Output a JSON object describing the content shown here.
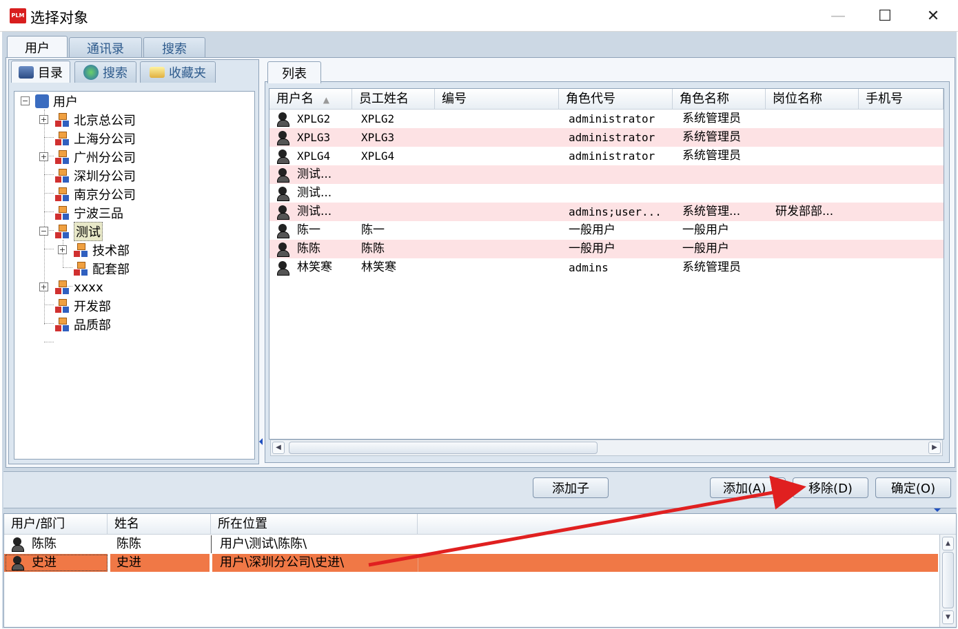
{
  "window": {
    "logo": "PLM",
    "title": "选择对象",
    "min_symbol": "—",
    "max_symbol": "☐",
    "close_symbol": "✕"
  },
  "main_tabs": [
    {
      "label": "用户",
      "active": true
    },
    {
      "label": "通讯录",
      "active": false
    },
    {
      "label": "搜索",
      "active": false
    }
  ],
  "sub_tabs": [
    {
      "label": "目录",
      "icon": "computer-icon"
    },
    {
      "label": "搜索",
      "icon": "globe-search-icon"
    },
    {
      "label": "收藏夹",
      "icon": "folder-icon"
    }
  ],
  "tree": {
    "root": "用户",
    "nodes": [
      {
        "label": "北京总公司"
      },
      {
        "label": "上海分公司"
      },
      {
        "label": "广州分公司"
      },
      {
        "label": "深圳分公司"
      },
      {
        "label": "南京分公司"
      },
      {
        "label": "宁波三品"
      },
      {
        "label": "测试",
        "selected": true
      },
      {
        "label": "技术部"
      },
      {
        "label": "配套部"
      },
      {
        "label": "xxxx"
      },
      {
        "label": "开发部"
      },
      {
        "label": "品质部"
      }
    ]
  },
  "list_tab": "列表",
  "list": {
    "columns": [
      "用户名",
      "员工姓名",
      "编号",
      "角色代号",
      "角色名称",
      "岗位名称",
      "手机号"
    ],
    "rows": [
      {
        "username": "XPLG2",
        "name": "XPLG2",
        "code": "",
        "role_code": "administrator",
        "role_name": "系统管理员",
        "post": "",
        "phone": ""
      },
      {
        "username": "XPLG3",
        "name": "XPLG3",
        "code": "",
        "role_code": "administrator",
        "role_name": "系统管理员",
        "post": "",
        "phone": ""
      },
      {
        "username": "XPLG4",
        "name": "XPLG4",
        "code": "",
        "role_code": "administrator",
        "role_name": "系统管理员",
        "post": "",
        "phone": ""
      },
      {
        "username": "测试...",
        "name": "",
        "code": "",
        "role_code": "",
        "role_name": "",
        "post": "",
        "phone": ""
      },
      {
        "username": "测试...",
        "name": "",
        "code": "",
        "role_code": "",
        "role_name": "",
        "post": "",
        "phone": ""
      },
      {
        "username": "测试...",
        "name": "",
        "code": "",
        "role_code": "admins;user...",
        "role_name": "系统管理...",
        "post": "研发部部...",
        "phone": ""
      },
      {
        "username": "陈一",
        "name": "陈一",
        "code": "",
        "role_code": "一般用户",
        "role_name": "一般用户",
        "post": "",
        "phone": ""
      },
      {
        "username": "陈陈",
        "name": "陈陈",
        "code": "",
        "role_code": "一般用户",
        "role_name": "一般用户",
        "post": "",
        "phone": ""
      },
      {
        "username": "林笑寒",
        "name": "林笑寒",
        "code": "",
        "role_code": "admins",
        "role_name": "系统管理员",
        "post": "",
        "phone": ""
      }
    ]
  },
  "buttons": {
    "add_child": "添加子",
    "add": "添加(A)",
    "remove": "移除(D)",
    "ok": "确定(O)"
  },
  "selected_table": {
    "columns": [
      "用户/部门",
      "姓名",
      "所在位置"
    ],
    "rows": [
      {
        "user": "陈陈",
        "name": "陈陈",
        "location": "用户\\测试\\陈陈\\"
      },
      {
        "user": "史进",
        "name": "史进",
        "location": "用户\\深圳分公司\\史进\\",
        "selected": true
      }
    ]
  },
  "colors": {
    "accent": "#f07846",
    "pink_row": "#fde2e4",
    "panel": "#ccd8e4",
    "arrow": "#e02020"
  }
}
